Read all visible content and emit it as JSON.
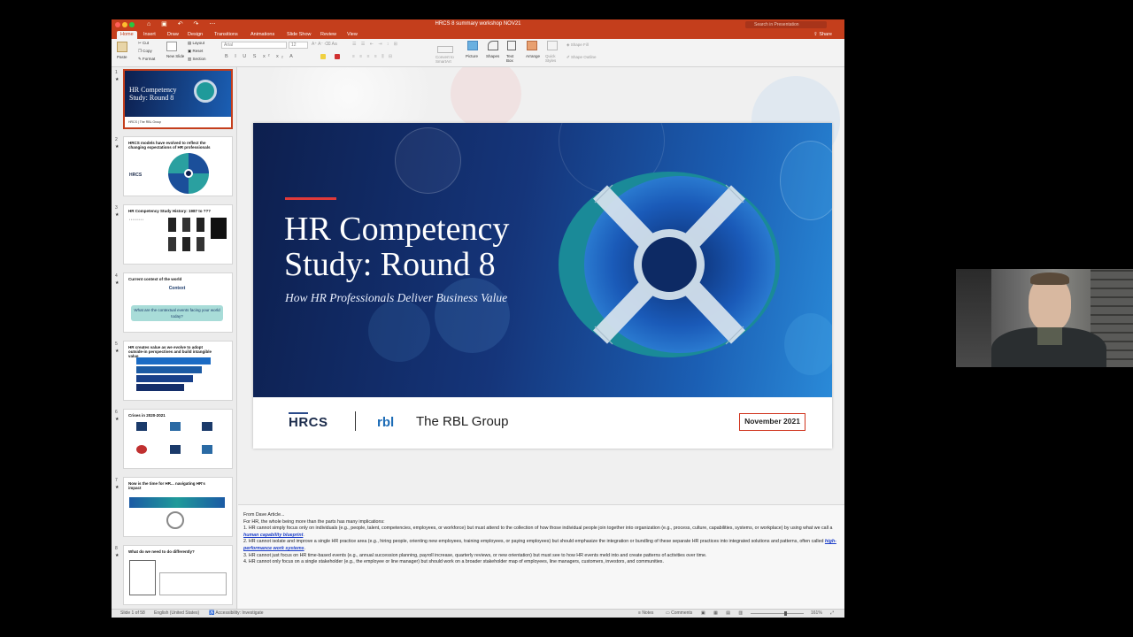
{
  "window": {
    "title": "HRCS 8 summary workshop NOV21",
    "search_placeholder": "Search in Presentation",
    "share_label": "Share",
    "traffic_colors": [
      "#ff5f57",
      "#febc2e",
      "#28c840"
    ]
  },
  "tabs": [
    "Home",
    "Insert",
    "Draw",
    "Design",
    "Transitions",
    "Animations",
    "Slide Show",
    "Review",
    "View"
  ],
  "active_tab": "Home",
  "ribbon": {
    "paste": "Paste",
    "cut": "Cut",
    "copy": "Copy",
    "format": "Format",
    "new_slide": "New Slide",
    "layout": "Layout",
    "reset": "Reset",
    "section": "Section",
    "font_name": "Arial",
    "font_size": "12",
    "convert_smartart": "Convert to SmartArt",
    "picture": "Picture",
    "shapes": "Shapes",
    "text_box": "Text Box",
    "arrange": "Arrange",
    "quick_styles": "Quick Styles",
    "shape_fill": "Shape Fill",
    "shape_outline": "Shape Outline"
  },
  "thumbnails": [
    {
      "num": "1",
      "title": "HR Competency Study: Round 8"
    },
    {
      "num": "2",
      "title": "HRCS models have evolved to reflect the changing expectations of HR professionals"
    },
    {
      "num": "3",
      "title": "HR Competency Study History: 1987 to ???"
    },
    {
      "num": "4",
      "title": "Current context of the world",
      "extra": "Context",
      "question": "What are the contextual events facing your world today?"
    },
    {
      "num": "5",
      "title": "HR creates value as we evolve to adopt outside-in perspectives and build intangible value"
    },
    {
      "num": "6",
      "title": "Crises in 2020-2021"
    },
    {
      "num": "7",
      "title": "Now is the time for HR... navigating HR's impact"
    },
    {
      "num": "8",
      "title": "What do we need to do differently?"
    }
  ],
  "slide": {
    "title": "HR Competency Study: Round 8",
    "subtitle": "How HR Professionals Deliver Business Value",
    "logo_hrcs": "HRCS",
    "logo_rbl_mark": "rbl",
    "logo_rbl_name": "The RBL Group",
    "date": "November 2021"
  },
  "notes": {
    "line0": "From Dave Article...",
    "line1": "For HR, the whole being more than the parts has many implications:",
    "item1_a": "1. HR cannot simply focus only on individuals (e.g., people, talent, competencies, employees, or workforce) but must attend to the collection of how those individual people join together into organization (e.g., process, culture, capabilities, systems, or workplace) by using what we call a ",
    "item1_link": "human capability blueprint",
    "item1_b": ".",
    "item2_a": "2. HR cannot isolate and improve a single HR practice area (e.g., hiring people, orienting new employees, training employees, or paying employees) but should emphasize the integration or bundling of these separate HR practices into integrated solutions and patterns, often called ",
    "item2_link": "high-performance work systems",
    "item2_b": ".",
    "item3": "3. HR cannot just focus on HR time-based events (e.g., annual succession planning, payroll increase, quarterly reviews, or new orientation) but must see to how HR events meld into and create patterns of activities over time.",
    "item4": "4. HR cannot only focus on a single stakeholder (e.g., the employee or line manager) but should work on a broader stakeholder map of employees, line managers, customers, investors, and communities."
  },
  "status": {
    "slide_count": "Slide 1 of 58",
    "language": "English (United States)",
    "accessibility": "Accessibility: Investigate",
    "notes": "Notes",
    "comments": "Comments",
    "zoom": "161%"
  }
}
